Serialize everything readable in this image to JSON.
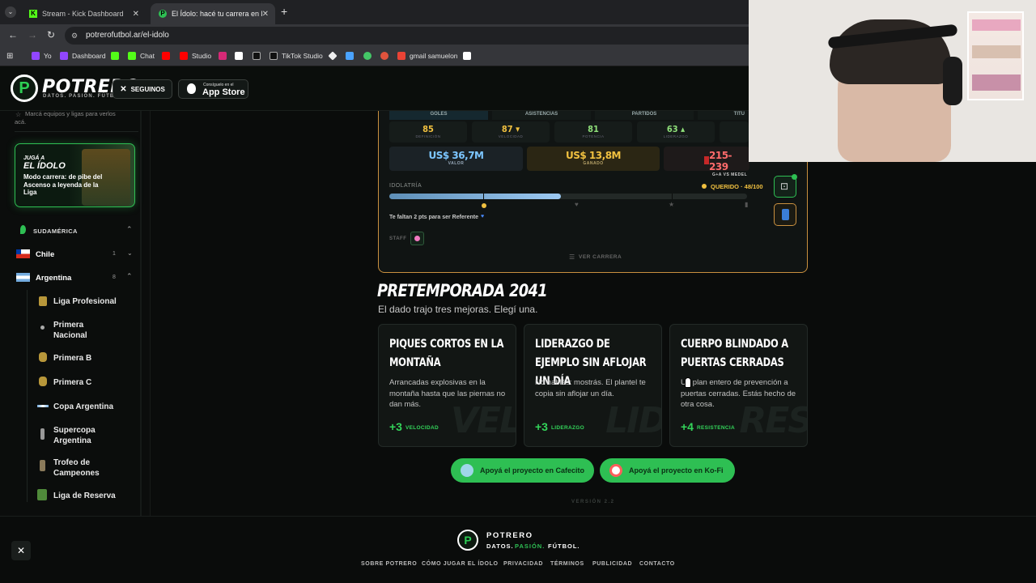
{
  "browser": {
    "tabs": [
      {
        "title": "Stream - Kick Dashboard",
        "active": false
      },
      {
        "title": "El Ídolo: hacé tu carrera en la Li",
        "active": true
      }
    ],
    "url": "potrerofutbol.ar/el-idolo",
    "bookmarks": [
      "Yo",
      "Dashboard",
      "Chat",
      "Studio",
      "TikTok Studio",
      "gmail samuelon"
    ]
  },
  "header": {
    "logo": "POTRERO",
    "tagline": "DATOS. PASIÓN. FÚTBOL.",
    "follow_label": "SEGUINOS",
    "appstore_small": "Consíguelo en el",
    "appstore_big": "App Store"
  },
  "sidebar": {
    "hint": "Marcá equipos y ligas para verlos acá.",
    "promo": {
      "kicker": "JUGÁ A",
      "title": "EL ÍDOLO",
      "body": "Modo carrera: de pibe del Ascenso a leyenda de la Liga"
    },
    "region": "SUDAMÉRICA",
    "countries": [
      {
        "name": "Chile",
        "count": "1"
      },
      {
        "name": "Argentina",
        "count": "8"
      }
    ],
    "leagues": [
      "Liga Profesional",
      "Primera Nacional",
      "Primera B",
      "Primera C",
      "Copa Argentina",
      "Supercopa Argentina",
      "Trofeo de Campeones",
      "Liga de Reserva"
    ]
  },
  "career_card": {
    "stat_tabs": [
      "GOLES",
      "ASISTENCIAS",
      "PARTIDOS",
      "TITU"
    ],
    "attributes": [
      {
        "value": "85",
        "label": "DEFINICIÓN",
        "color": "#f0c040"
      },
      {
        "value": "87 ▾",
        "label": "VELOCIDAD",
        "color": "#f0c040"
      },
      {
        "value": "81",
        "label": "POTENCIA",
        "color": "#8fe07a"
      },
      {
        "value": "63 ▴",
        "label": "LIDERAZGO",
        "color": "#8fe07a"
      }
    ],
    "valor": {
      "value": "US$ 36,7M",
      "label": "VALOR"
    },
    "ganado": {
      "value": "US$ 13,8M",
      "label": "GANADO"
    },
    "record": {
      "value": "215-239",
      "label": "G+A VS MEDEL"
    },
    "idolatria_label": "IDOLATRÍA",
    "idolatria_status": "QUERIDO · 48/100",
    "idolatria_progress": 0.48,
    "referente_msg": "Te faltan 2 pts para ser Referente",
    "staff_label": "STAFF",
    "ver_carrera": "VER CARRERA"
  },
  "preseason": {
    "title": "PRETEMPORADA 2041",
    "subtitle": "El dado trajo tres mejoras. Elegí una.",
    "options": [
      {
        "title": "PIQUES CORTOS EN LA MONTAÑA",
        "desc": "Arrancadas explosivas en la montaña hasta que las piernas no dan más.",
        "bonus": "+3",
        "stat": "VELOCIDAD",
        "watermark": "VEL"
      },
      {
        "title": "LIDERAZGO DE EJEMPLO SIN AFLOJAR UN DÍA",
        "desc": "No hablás: mostrás. El plantel te copia sin aflojar un día.",
        "bonus": "+3",
        "stat": "LIDERAZGO",
        "watermark": "LID"
      },
      {
        "title": "CUERPO BLINDADO A PUERTAS CERRADAS",
        "desc": "Un plan entero de prevención a puertas cerradas. Estás hecho de otra cosa.",
        "bonus": "+4",
        "stat": "RESISTENCIA",
        "watermark": "RES"
      }
    ]
  },
  "support": {
    "cafecito": "Apoyá el proyecto en Cafecito",
    "kofi": "Apoyá el proyecto en Ko-Fi"
  },
  "version": "VERSIÓN 2.2",
  "footer": {
    "brand": "POTRERO",
    "tag1": "DATOS.",
    "tag2": "PASIÓN.",
    "tag3": "FÚTBOL.",
    "links": [
      "SOBRE POTRERO",
      "CÓMO JUGAR EL ÍDOLO",
      "PRIVACIDAD",
      "TÉRMINOS",
      "PUBLICIDAD",
      "CONTACTO"
    ]
  },
  "colors": {
    "accent": "#2ebf53",
    "gold": "#c9903f",
    "bg": "#0a0c0b"
  }
}
